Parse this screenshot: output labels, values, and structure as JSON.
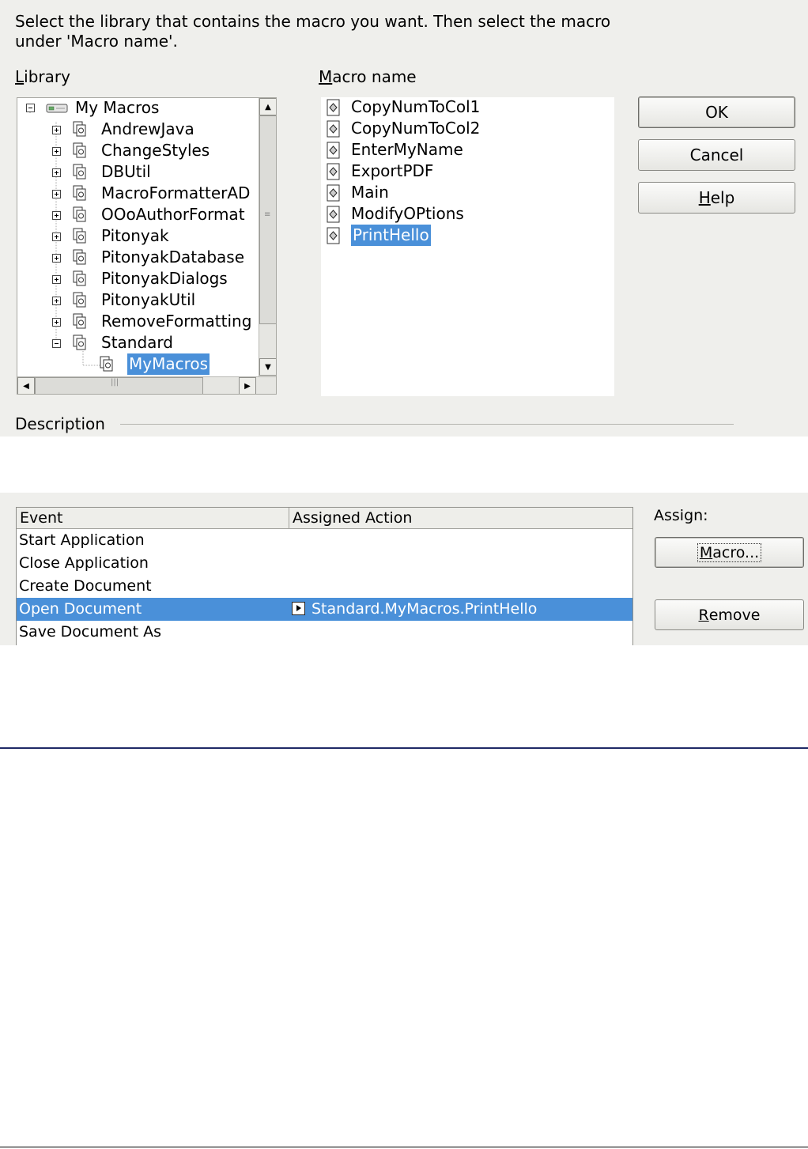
{
  "macro_dialog": {
    "instruction": "Select the library that contains the macro you want. Then select the macro under 'Macro name'.",
    "library_label": {
      "accel": "L",
      "rest": "ibrary"
    },
    "macro_name_label": {
      "accel": "M",
      "rest": "acro name"
    },
    "library_tree": {
      "root": "My Macros",
      "items": [
        {
          "label": "AndrewJava",
          "state": "collapsed"
        },
        {
          "label": "ChangeStyles",
          "state": "collapsed"
        },
        {
          "label": "DBUtil",
          "state": "collapsed"
        },
        {
          "label": "MacroFormatterAD",
          "state": "collapsed"
        },
        {
          "label": "OOoAuthorFormat",
          "state": "collapsed"
        },
        {
          "label": "Pitonyak",
          "state": "collapsed"
        },
        {
          "label": "PitonyakDatabase",
          "state": "collapsed"
        },
        {
          "label": "PitonyakDialogs",
          "state": "collapsed"
        },
        {
          "label": "PitonyakUtil",
          "state": "collapsed"
        },
        {
          "label": "RemoveFormatting",
          "state": "collapsed"
        },
        {
          "label": "Standard",
          "state": "expanded"
        }
      ],
      "child": {
        "label": "MyMacros",
        "selected": true
      }
    },
    "macros": [
      {
        "label": "CopyNumToCol1"
      },
      {
        "label": "CopyNumToCol2"
      },
      {
        "label": "EnterMyName"
      },
      {
        "label": "ExportPDF"
      },
      {
        "label": "Main"
      },
      {
        "label": "ModifyOPtions"
      },
      {
        "label": "PrintHello",
        "selected": true
      }
    ],
    "buttons": {
      "ok": "OK",
      "cancel": "Cancel",
      "help": {
        "accel": "H",
        "rest": "elp"
      }
    },
    "description_label": "Description",
    "colors": {
      "dialog_bg": "#efefec",
      "selection": "#4a90d9"
    }
  },
  "events_dialog": {
    "columns": [
      "Event",
      "Assigned Action"
    ],
    "rows": [
      {
        "event": "Start Application",
        "action": ""
      },
      {
        "event": "Close Application",
        "action": ""
      },
      {
        "event": "Create Document",
        "action": ""
      },
      {
        "event": "Open Document",
        "action": "Standard.MyMacros.PrintHello",
        "selected": true
      },
      {
        "event": "Save Document As",
        "action": ""
      }
    ],
    "assign_label": "Assign:",
    "macro_button": {
      "accel": "M",
      "rest": "acro..."
    },
    "remove_button": {
      "accel": "R",
      "rest": "emove"
    }
  }
}
